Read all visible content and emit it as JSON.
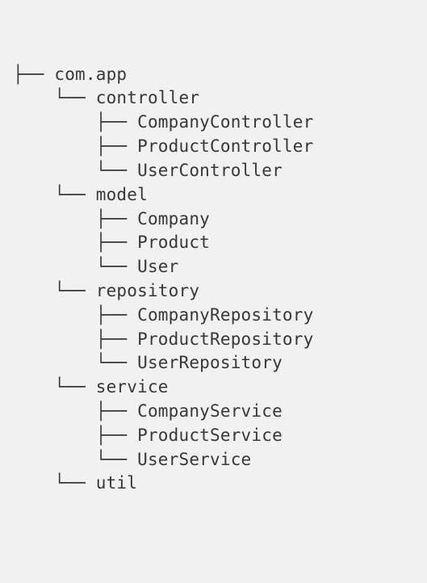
{
  "tree": {
    "lines": [
      "├── com.app",
      "    └── controller",
      "        ├── CompanyController",
      "        ├── ProductController",
      "        └── UserController",
      "    └── model",
      "        ├── Company",
      "        ├── Product",
      "        └── User",
      "    └── repository",
      "        ├── CompanyRepository",
      "        ├── ProductRepository",
      "        └── UserRepository",
      "    └── service",
      "        ├── CompanyService",
      "        ├── ProductService",
      "        └── UserService",
      "    └── util"
    ]
  }
}
